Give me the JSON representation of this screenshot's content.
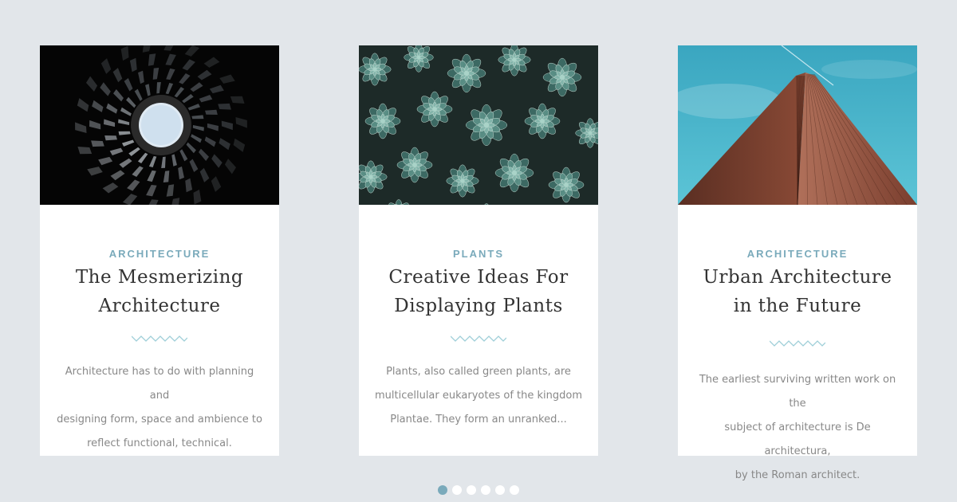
{
  "cards": [
    {
      "category": "ARCHITECTURE",
      "title_lines": [
        "The Mesmerizing",
        "Architecture"
      ],
      "excerpt_lines": [
        "Architecture has to do with planning and",
        "designing form, space and ambience to",
        "reflect functional, technical."
      ],
      "image_icon": "spiral-architecture-photo"
    },
    {
      "category": "PLANTS",
      "title_lines": [
        "Creative Ideas For",
        "Displaying Plants"
      ],
      "excerpt_lines": [
        "Plants, also called green plants, are",
        "multicellular eukaryotes of the kingdom",
        "Plantae. They form an unranked..."
      ],
      "image_icon": "succulents-photo"
    },
    {
      "category": "ARCHITECTURE",
      "title_lines": [
        "Urban Architecture",
        "in the Future"
      ],
      "excerpt_lines": [
        "The earliest surviving written work on the",
        "subject of architecture is De architectura,",
        "by the Roman architect."
      ],
      "image_icon": "skyscraper-photo"
    }
  ],
  "pagination": {
    "total": 6,
    "active_index": 0
  },
  "colors": {
    "background": "#e2e6ea",
    "accent": "#7aaabb",
    "title": "#333333",
    "excerpt": "#888888"
  }
}
